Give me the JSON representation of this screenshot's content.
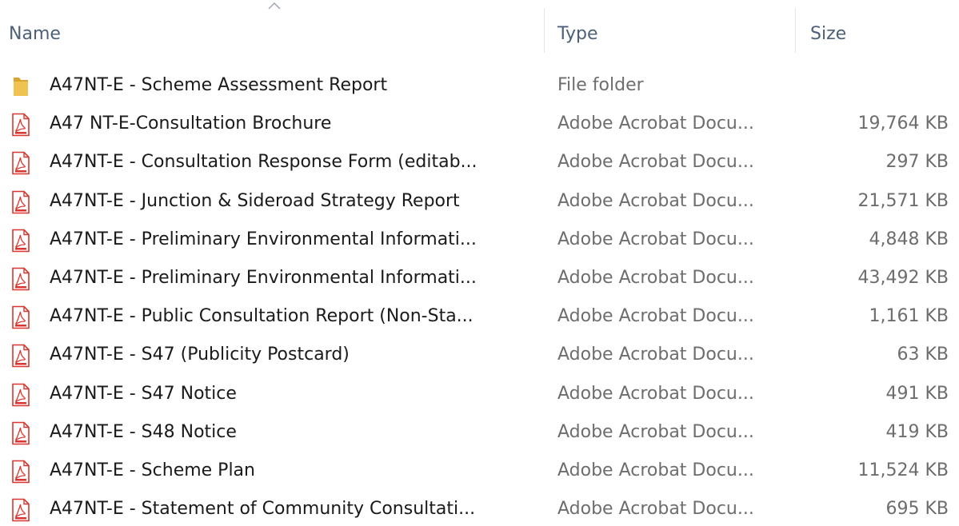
{
  "columns": {
    "name": "Name",
    "type": "Type",
    "size": "Size"
  },
  "sort": {
    "column": "name",
    "direction": "ascending",
    "icon": "sort-ascending-icon"
  },
  "colors": {
    "header_text": "#4c607a",
    "name_text": "#1a1a1a",
    "meta_text": "#6d6d6d",
    "folder_yellow": "#e8b73e",
    "pdf_red": "#d9362f"
  },
  "files": [
    {
      "icon": "folder-icon",
      "name": "A47NT-E - Scheme Assessment Report",
      "type": "File folder",
      "size": ""
    },
    {
      "icon": "pdf-icon",
      "name": "A47 NT-E-Consultation Brochure",
      "type": "Adobe Acrobat Docu...",
      "size": "19,764 KB"
    },
    {
      "icon": "pdf-icon",
      "name": "A47NT-E - Consultation Response Form (editab...",
      "type": "Adobe Acrobat Docu...",
      "size": "297 KB"
    },
    {
      "icon": "pdf-icon",
      "name": "A47NT-E - Junction & Sideroad Strategy Report",
      "type": "Adobe Acrobat Docu...",
      "size": "21,571 KB"
    },
    {
      "icon": "pdf-icon",
      "name": "A47NT-E - Preliminary Environmental Informati...",
      "type": "Adobe Acrobat Docu...",
      "size": "4,848 KB"
    },
    {
      "icon": "pdf-icon",
      "name": "A47NT-E - Preliminary Environmental Informati...",
      "type": "Adobe Acrobat Docu...",
      "size": "43,492 KB"
    },
    {
      "icon": "pdf-icon",
      "name": "A47NT-E - Public Consultation Report (Non-Sta...",
      "type": "Adobe Acrobat Docu...",
      "size": "1,161 KB"
    },
    {
      "icon": "pdf-icon",
      "name": "A47NT-E - S47 (Publicity Postcard)",
      "type": "Adobe Acrobat Docu...",
      "size": "63 KB"
    },
    {
      "icon": "pdf-icon",
      "name": "A47NT-E - S47 Notice",
      "type": "Adobe Acrobat Docu...",
      "size": "491 KB"
    },
    {
      "icon": "pdf-icon",
      "name": "A47NT-E - S48 Notice",
      "type": "Adobe Acrobat Docu...",
      "size": "419 KB"
    },
    {
      "icon": "pdf-icon",
      "name": "A47NT-E - Scheme Plan",
      "type": "Adobe Acrobat Docu...",
      "size": "11,524 KB"
    },
    {
      "icon": "pdf-icon",
      "name": "A47NT-E - Statement of Community Consultati...",
      "type": "Adobe Acrobat Docu...",
      "size": "695 KB"
    }
  ]
}
